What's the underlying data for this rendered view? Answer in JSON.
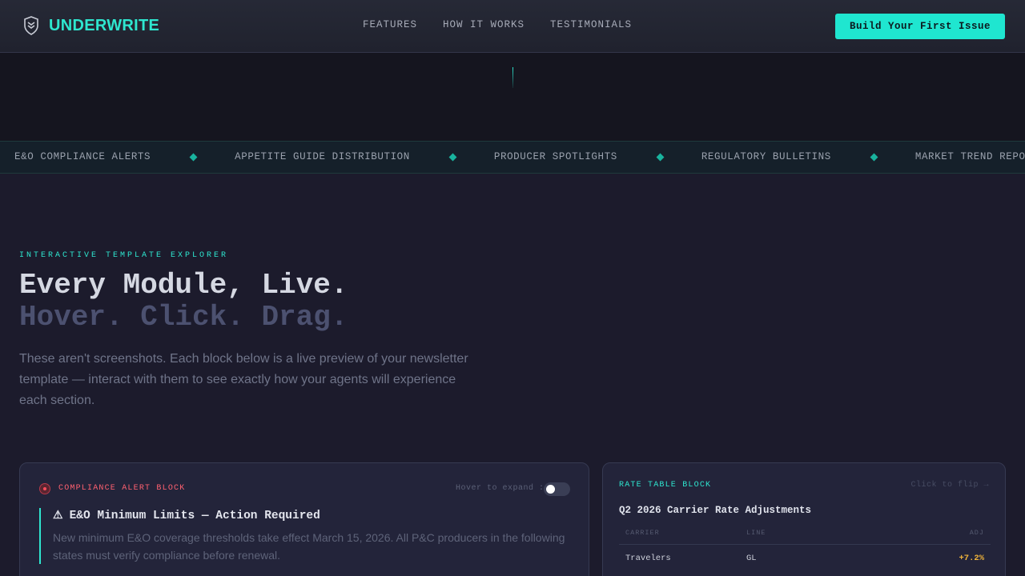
{
  "nav": {
    "brand": "UNDERWRITE",
    "links": [
      "FEATURES",
      "HOW IT WORKS",
      "TESTIMONIALS"
    ],
    "cta": "Build Your First Issue"
  },
  "marquee": {
    "items": [
      "E&O COMPLIANCE ALERTS",
      "APPETITE GUIDE DISTRIBUTION",
      "PRODUCER SPOTLIGHTS",
      "REGULATORY BULLETINS",
      "MARKET TREND REPORTS"
    ]
  },
  "hero": {
    "eyebrow": "INTERACTIVE TEMPLATE EXPLORER",
    "title_line1": "Every Module, Live.",
    "title_line2": "Hover. Click. Drag.",
    "lede": "These aren't screenshots. Each block below is a live preview of your newsletter template — interact with them to see exactly how your agents will experience each section."
  },
  "compliance_block": {
    "label": "COMPLIANCE ALERT BLOCK",
    "hint": "Hover to expand",
    "toggle_on": false,
    "title": "E&O Minimum Limits — Action Required",
    "text": "New minimum E&O coverage thresholds take effect March 15, 2026. All P&C producers in the following states must verify compliance before renewal."
  },
  "rate_block": {
    "label": "RATE TABLE BLOCK",
    "hint": "Click to flip →",
    "title": "Q2 2026 Carrier Rate Adjustments",
    "columns": [
      "CARRIER",
      "LINE",
      "ADJ"
    ],
    "rows": [
      {
        "carrier": "Travelers",
        "line": "GL",
        "adj": "+7.2%"
      }
    ]
  },
  "colors": {
    "accent": "#2ee6cf",
    "alert": "#ff6170",
    "positive_adj": "#f2b53a"
  }
}
